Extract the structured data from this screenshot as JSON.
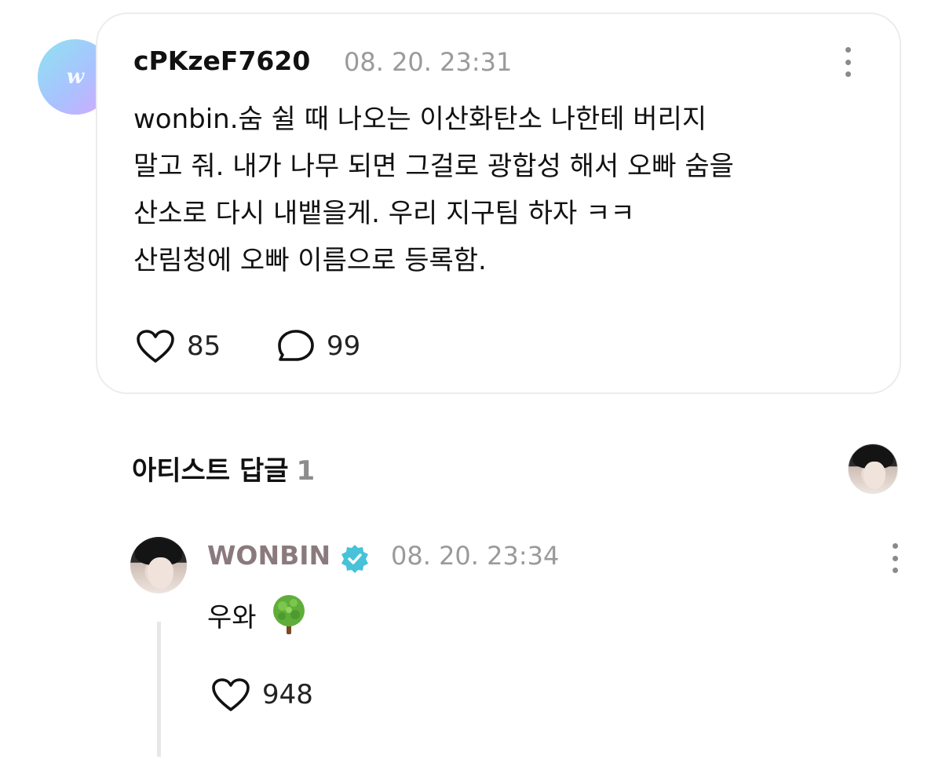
{
  "post": {
    "avatar_letter": "w",
    "username": "cPKzeF7620",
    "timestamp": "08. 20. 23:31",
    "body_lines": [
      "wonbin.숨 쉴 때 나오는 이산화탄소 나한테 버리지",
      "말고 줘. 내가 나무 되면 그걸로 광합성 해서 오빠 숨을",
      "산소로 다시 내뱉을게. 우리 지구팀 하자 ㅋㅋ",
      "산림청에 오빠 이름으로 등록함."
    ],
    "likes": "85",
    "comments": "99"
  },
  "artist_replies": {
    "title": "아티스트 답글",
    "count": "1"
  },
  "reply": {
    "name": "WONBIN",
    "timestamp": "08. 20. 23:34",
    "text": "우와",
    "likes": "948"
  },
  "icons": {
    "like": "heart-outline-icon",
    "comment": "speech-bubble-icon",
    "more": "kebab-menu-icon",
    "verified": "verified-badge-icon",
    "emoji": "tree-emoji"
  },
  "colors": {
    "artist_name": "#8a7a7e",
    "verified_badge": "#47c2d8",
    "muted_text": "#9a9a9a"
  }
}
